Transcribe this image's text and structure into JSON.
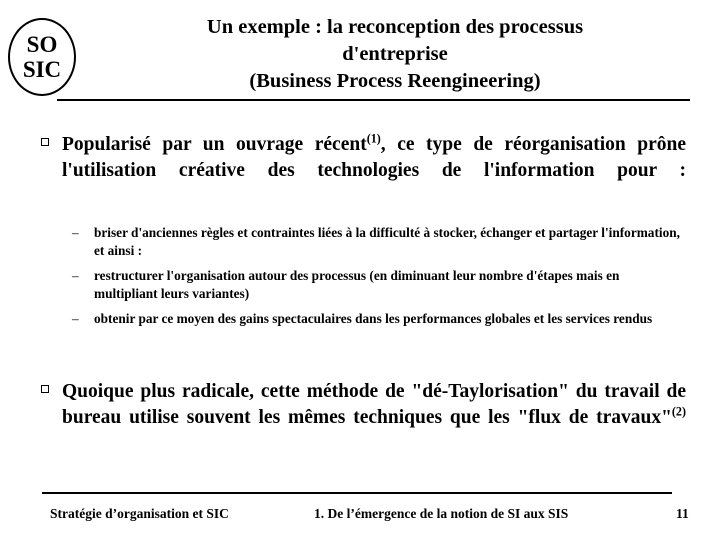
{
  "logo": {
    "line1": "SO",
    "line2": "SIC"
  },
  "header": {
    "title_line1": "Un exemple : la reconception des processus",
    "title_line2": "d'entreprise",
    "title_line3": "(Business Process Reengineering)"
  },
  "content": {
    "bullet1": {
      "marker": "square-bullet",
      "text_before_sup": "Popularisé par un ouvrage récent",
      "sup": "(1)",
      "text_after_sup": ", ce type de réorganisation prône l'utilisation créative des technologies de l'information pour :"
    },
    "sub_bullets": [
      {
        "marker": "–",
        "text": "briser d'anciennes règles et contraintes liées à la difficulté à stocker, échanger et partager l'information, et ainsi :"
      },
      {
        "marker": "–",
        "text": "restructurer l'organisation autour des processus (en diminuant leur nombre d'étapes mais en multipliant leurs variantes)"
      },
      {
        "marker": "–",
        "text": "obtenir par ce moyen des gains spectaculaires dans les performances globales et les services rendus"
      }
    ],
    "bullet2": {
      "marker": "square-bullet",
      "text_before_sup": "Quoique plus radicale, cette méthode de \"dé-Taylorisation\" du travail de bureau utilise souvent les mêmes techniques que les \"flux de travaux\"",
      "sup": "(2)",
      "text_after_sup": ""
    }
  },
  "footer": {
    "left": "Stratégie d’organisation et SIC",
    "center": "1. De l’émergence de la notion de SI aux SIS",
    "page": "11"
  },
  "colors": {
    "text": "#000000",
    "background": "#ffffff",
    "rule": "#000000"
  }
}
